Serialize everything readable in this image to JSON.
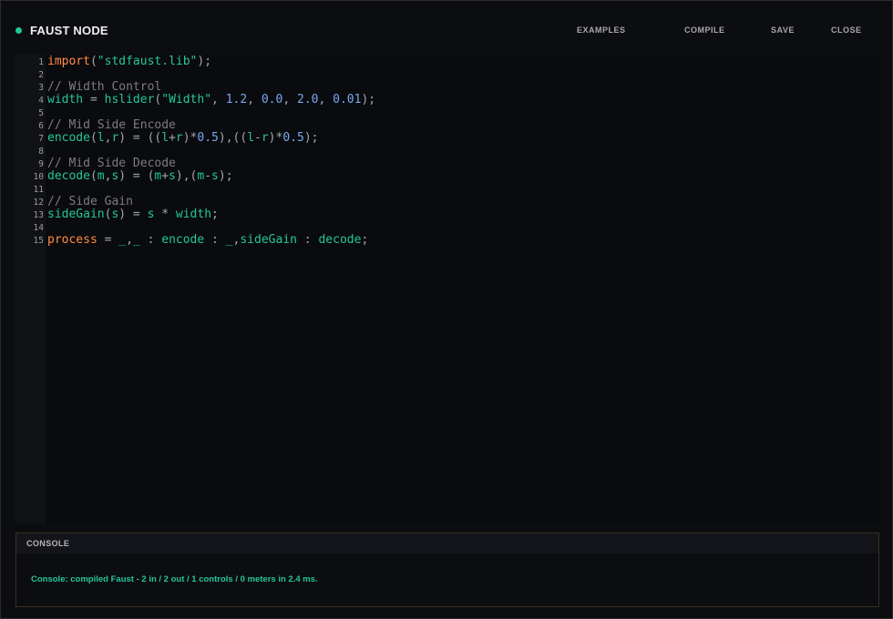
{
  "header": {
    "title": "FAUST NODE",
    "status_color": "#1fc99a",
    "status_icon": "status-dot-icon",
    "buttons": [
      {
        "label": "EXAMPLES"
      },
      {
        "label": "COMPILE"
      },
      {
        "label": "SAVE"
      },
      {
        "label": "CLOSE"
      }
    ]
  },
  "editor": {
    "language": "faust",
    "colors": {
      "keyword": "#ff8c42",
      "string": "#23c79b",
      "comment": "#7c7c82",
      "identifier": "#23c79b",
      "number": "#78a8f0",
      "punctuation": "#a0a6ae"
    },
    "lines": [
      {
        "n": "1",
        "tokens": [
          {
            "t": "import",
            "c": "keyword"
          },
          {
            "t": "(",
            "c": "punctuation"
          },
          {
            "t": "\"stdfaust.lib\"",
            "c": "string"
          },
          {
            "t": ");",
            "c": "punctuation"
          }
        ]
      },
      {
        "n": "2",
        "tokens": []
      },
      {
        "n": "3",
        "tokens": [
          {
            "t": "// Width Control",
            "c": "comment"
          }
        ]
      },
      {
        "n": "4",
        "tokens": [
          {
            "t": "width",
            "c": "identifier"
          },
          {
            "t": " = ",
            "c": "punctuation"
          },
          {
            "t": "hslider",
            "c": "identifier"
          },
          {
            "t": "(",
            "c": "punctuation"
          },
          {
            "t": "\"Width\"",
            "c": "string"
          },
          {
            "t": ", ",
            "c": "punctuation"
          },
          {
            "t": "1.2",
            "c": "number"
          },
          {
            "t": ", ",
            "c": "punctuation"
          },
          {
            "t": "0.0",
            "c": "number"
          },
          {
            "t": ", ",
            "c": "punctuation"
          },
          {
            "t": "2.0",
            "c": "number"
          },
          {
            "t": ", ",
            "c": "punctuation"
          },
          {
            "t": "0.01",
            "c": "number"
          },
          {
            "t": ");",
            "c": "punctuation"
          }
        ]
      },
      {
        "n": "5",
        "tokens": []
      },
      {
        "n": "6",
        "tokens": [
          {
            "t": "// Mid Side Encode",
            "c": "comment"
          }
        ]
      },
      {
        "n": "7",
        "tokens": [
          {
            "t": "encode",
            "c": "identifier"
          },
          {
            "t": "(",
            "c": "punctuation"
          },
          {
            "t": "l",
            "c": "identifier"
          },
          {
            "t": ",",
            "c": "punctuation"
          },
          {
            "t": "r",
            "c": "identifier"
          },
          {
            "t": ") = ((",
            "c": "punctuation"
          },
          {
            "t": "l",
            "c": "identifier"
          },
          {
            "t": "+",
            "c": "punctuation"
          },
          {
            "t": "r",
            "c": "identifier"
          },
          {
            "t": ")*",
            "c": "punctuation"
          },
          {
            "t": "0.5",
            "c": "number"
          },
          {
            "t": "),((",
            "c": "punctuation"
          },
          {
            "t": "l",
            "c": "identifier"
          },
          {
            "t": "-",
            "c": "punctuation"
          },
          {
            "t": "r",
            "c": "identifier"
          },
          {
            "t": ")*",
            "c": "punctuation"
          },
          {
            "t": "0.5",
            "c": "number"
          },
          {
            "t": ");",
            "c": "punctuation"
          }
        ]
      },
      {
        "n": "8",
        "tokens": []
      },
      {
        "n": "9",
        "tokens": [
          {
            "t": "// Mid Side Decode",
            "c": "comment"
          }
        ]
      },
      {
        "n": "10",
        "tokens": [
          {
            "t": "decode",
            "c": "identifier"
          },
          {
            "t": "(",
            "c": "punctuation"
          },
          {
            "t": "m",
            "c": "identifier"
          },
          {
            "t": ",",
            "c": "punctuation"
          },
          {
            "t": "s",
            "c": "identifier"
          },
          {
            "t": ") = (",
            "c": "punctuation"
          },
          {
            "t": "m",
            "c": "identifier"
          },
          {
            "t": "+",
            "c": "punctuation"
          },
          {
            "t": "s",
            "c": "identifier"
          },
          {
            "t": "),(",
            "c": "punctuation"
          },
          {
            "t": "m",
            "c": "identifier"
          },
          {
            "t": "-",
            "c": "punctuation"
          },
          {
            "t": "s",
            "c": "identifier"
          },
          {
            "t": ");",
            "c": "punctuation"
          }
        ]
      },
      {
        "n": "11",
        "tokens": []
      },
      {
        "n": "12",
        "tokens": [
          {
            "t": "// Side Gain",
            "c": "comment"
          }
        ]
      },
      {
        "n": "13",
        "tokens": [
          {
            "t": "sideGain",
            "c": "identifier"
          },
          {
            "t": "(",
            "c": "punctuation"
          },
          {
            "t": "s",
            "c": "identifier"
          },
          {
            "t": ") = ",
            "c": "punctuation"
          },
          {
            "t": "s",
            "c": "identifier"
          },
          {
            "t": " * ",
            "c": "punctuation"
          },
          {
            "t": "width",
            "c": "identifier"
          },
          {
            "t": ";",
            "c": "punctuation"
          }
        ]
      },
      {
        "n": "14",
        "tokens": []
      },
      {
        "n": "15",
        "tokens": [
          {
            "t": "process",
            "c": "keyword"
          },
          {
            "t": " = ",
            "c": "punctuation"
          },
          {
            "t": "_",
            "c": "identifier"
          },
          {
            "t": ",",
            "c": "punctuation"
          },
          {
            "t": "_",
            "c": "identifier"
          },
          {
            "t": " : ",
            "c": "punctuation"
          },
          {
            "t": "encode",
            "c": "identifier"
          },
          {
            "t": " : ",
            "c": "punctuation"
          },
          {
            "t": "_",
            "c": "identifier"
          },
          {
            "t": ",",
            "c": "punctuation"
          },
          {
            "t": "sideGain",
            "c": "identifier"
          },
          {
            "t": " : ",
            "c": "punctuation"
          },
          {
            "t": "decode",
            "c": "identifier"
          },
          {
            "t": ";",
            "c": "punctuation"
          }
        ]
      }
    ]
  },
  "console": {
    "title": "CONSOLE",
    "message": "Console: compiled Faust - 2 in / 2 out / 1 controls / 0 meters in 2.4 ms.",
    "message_color": "#23c79b"
  }
}
